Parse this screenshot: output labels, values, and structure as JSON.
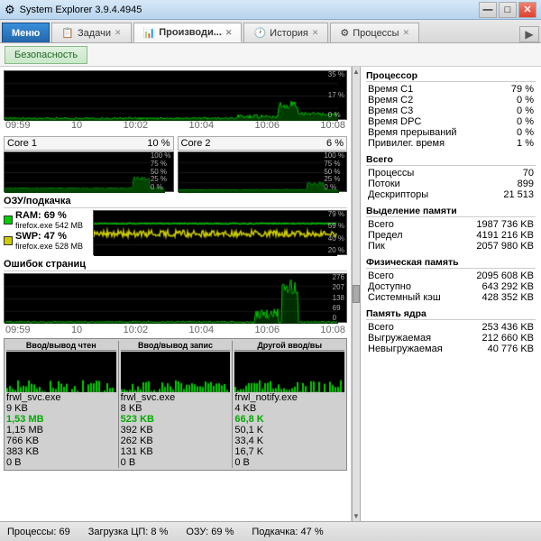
{
  "titleBar": {
    "icon": "⚙",
    "title": "System Explorer 3.9.4.4945",
    "minimizeLabel": "—",
    "maximizeLabel": "□",
    "closeLabel": "✕"
  },
  "tabs": [
    {
      "id": "menu",
      "label": "Меню",
      "active": false,
      "icon": ""
    },
    {
      "id": "tasks",
      "label": "Задачи",
      "active": false,
      "icon": "📋"
    },
    {
      "id": "performance",
      "label": "Производи...",
      "active": true,
      "icon": "📊"
    },
    {
      "id": "history",
      "label": "История",
      "active": false,
      "icon": "🕐"
    },
    {
      "id": "processes",
      "label": "Процессы",
      "active": false,
      "icon": "⚙"
    }
  ],
  "toolbar": {
    "securityLabel": "Безопасность"
  },
  "charts": {
    "cpuMainLabel": "",
    "xLabels": [
      "09:59",
      "10",
      "10:02",
      "10:04",
      "10:06",
      "10:08"
    ],
    "yLabels": [
      "35 %",
      "17 %",
      "0 %"
    ],
    "coreLabels": [
      "Core 1",
      "Core 2"
    ],
    "core1Percent": "10 %",
    "core2Percent": "6 %",
    "coreYLabels": [
      "100 %",
      "75 %",
      "50 %",
      "25 %",
      "0 %"
    ],
    "ramSection": "ОЗУ/подкачка",
    "ramLabel": "RAM: 69 %",
    "ramDetail": "firefox.exe 542 MB",
    "swpLabel": "SWP: 47 %",
    "swpDetail": "firefox.exe 528 MB",
    "ramYLabels": [
      "79 %",
      "59 %",
      "40 %",
      "20 %"
    ],
    "pageFaultSection": "Ошибок страниц",
    "pageFaultYLabels": [
      "276",
      "207",
      "138",
      "69 %"
    ],
    "ioSection": "Ввод/вывод чтен Ввод/вывод запис Другой ввод/вы",
    "ioRead": {
      "title": "Ввод/вывод чтен",
      "top": "1,53 MB",
      "mid": "1,15 MB",
      "items": [
        "frwl_svc.exe",
        "9 KB",
        "766 KB",
        "383 KB",
        "0 B"
      ]
    },
    "ioWrite": {
      "title": "Ввод/вывод запис",
      "top": "523 KB",
      "mid": "392 KB",
      "items": [
        "frwl_svc.exe",
        "8 KB",
        "262 KB",
        "131 KB",
        "0 B"
      ]
    },
    "ioOther": {
      "title": "Другой ввод/вы",
      "top": "66,8 K",
      "mid": "50,1 K",
      "items": [
        "frwl_notify.ex",
        "4 KB",
        "33,4 K",
        "16,7 K",
        "0 B"
      ]
    }
  },
  "rightPanel": {
    "processorSection": "Процессор",
    "processorRows": [
      {
        "label": "Время С1",
        "value": "79 %"
      },
      {
        "label": "Время С2",
        "value": "0 %"
      },
      {
        "label": "Время С3",
        "value": "0 %"
      },
      {
        "label": "Время DPC",
        "value": "0 %"
      },
      {
        "label": "Время прерываний",
        "value": "0 %"
      },
      {
        "label": "Привилег. время",
        "value": "1 %"
      }
    ],
    "totalSection": "Всего",
    "totalRows": [
      {
        "label": "Процессы",
        "value": "70"
      },
      {
        "label": "Потоки",
        "value": "899"
      },
      {
        "label": "Дескрипторы",
        "value": "21 513"
      }
    ],
    "memAllocSection": "Выделение памяти",
    "memAllocRows": [
      {
        "label": "Всего",
        "value": "1987 736 KB"
      },
      {
        "label": "Предел",
        "value": "4191 216 KB"
      },
      {
        "label": "Пик",
        "value": "2057 980 KB"
      }
    ],
    "physMemSection": "Физическая память",
    "physMemRows": [
      {
        "label": "Всего",
        "value": "2095 608 KB"
      },
      {
        "label": "Доступно",
        "value": "643 292 KB"
      },
      {
        "label": "Системный кэш",
        "value": "428 352 KB"
      }
    ],
    "kernelSection": "Память ядра",
    "kernelRows": [
      {
        "label": "Всего",
        "value": "253 436 KB"
      },
      {
        "label": "Выгружаемая",
        "value": "212 660 KB"
      },
      {
        "label": "Невыгружаемая",
        "value": "40 776 KB"
      }
    ]
  },
  "statusBar": {
    "processes": "Процессы: 69",
    "cpuLoad": "Загрузка ЦП: 8 %",
    "ram": "ОЗУ: 69 %",
    "swap": "Подкачка: 47 %"
  }
}
